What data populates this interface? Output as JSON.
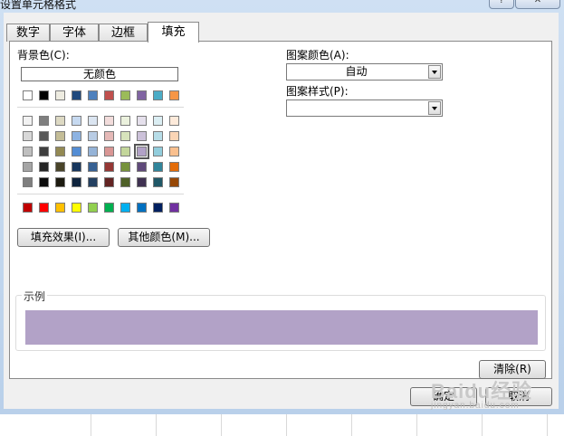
{
  "dialog": {
    "title": "设置单元格格式",
    "help_label": "?",
    "close_label": "✕"
  },
  "tabs": [
    {
      "label": "数字"
    },
    {
      "label": "字体"
    },
    {
      "label": "边框"
    },
    {
      "label": "填充",
      "active": true
    }
  ],
  "fill": {
    "background_label": "背景色(C):",
    "no_color_label": "无颜色",
    "theme_row": [
      "#ffffff",
      "#000000",
      "#eeece1",
      "#1f497d",
      "#4f81bd",
      "#c0504d",
      "#9bbb59",
      "#8064a2",
      "#4bacc6",
      "#f79646"
    ],
    "tint_rows": [
      [
        "#f2f2f2",
        "#7f7f7f",
        "#ddd9c3",
        "#c6d9f0",
        "#dbe5f1",
        "#f2dcdb",
        "#ebf1dd",
        "#e5e0ec",
        "#dbeef3",
        "#fdeada"
      ],
      [
        "#d8d8d8",
        "#595959",
        "#c4bd97",
        "#8db3e2",
        "#b8cce4",
        "#e5b9b7",
        "#d7e3bc",
        "#ccc1d9",
        "#b7dde8",
        "#fbd5b5"
      ],
      [
        "#bfbfbf",
        "#3f3f3f",
        "#938953",
        "#548dd4",
        "#95b3d7",
        "#d99694",
        "#c3d69b",
        "#b2a2c7",
        "#92cddc",
        "#fac08f"
      ],
      [
        "#a5a5a5",
        "#262626",
        "#494429",
        "#17365d",
        "#366092",
        "#953734",
        "#76923c",
        "#5f497a",
        "#31859b",
        "#e36c09"
      ],
      [
        "#7f7f7f",
        "#0c0c0c",
        "#1d1b10",
        "#0f243e",
        "#244061",
        "#632423",
        "#4f6128",
        "#3f3151",
        "#205867",
        "#974806"
      ]
    ],
    "selected_color": "#b2a2c7",
    "standard_row": [
      "#c00000",
      "#ff0000",
      "#ffc000",
      "#ffff00",
      "#92d050",
      "#00b050",
      "#00b0f0",
      "#0070c0",
      "#002060",
      "#7030a0"
    ],
    "fill_effects_label": "填充效果(I)...",
    "more_colors_label": "其他颜色(M)...",
    "pattern_color_label": "图案颜色(A):",
    "pattern_color_value": "自动",
    "pattern_style_label": "图案样式(P):",
    "pattern_style_value": "",
    "sample_label": "示例",
    "sample_color": "#b2a2c7",
    "clear_label": "清除(R)"
  },
  "footer": {
    "ok_label": "确定",
    "cancel_label": "取消"
  },
  "watermark": {
    "text": "Baidu经验",
    "subtext": "jingyan.baidu.com"
  }
}
